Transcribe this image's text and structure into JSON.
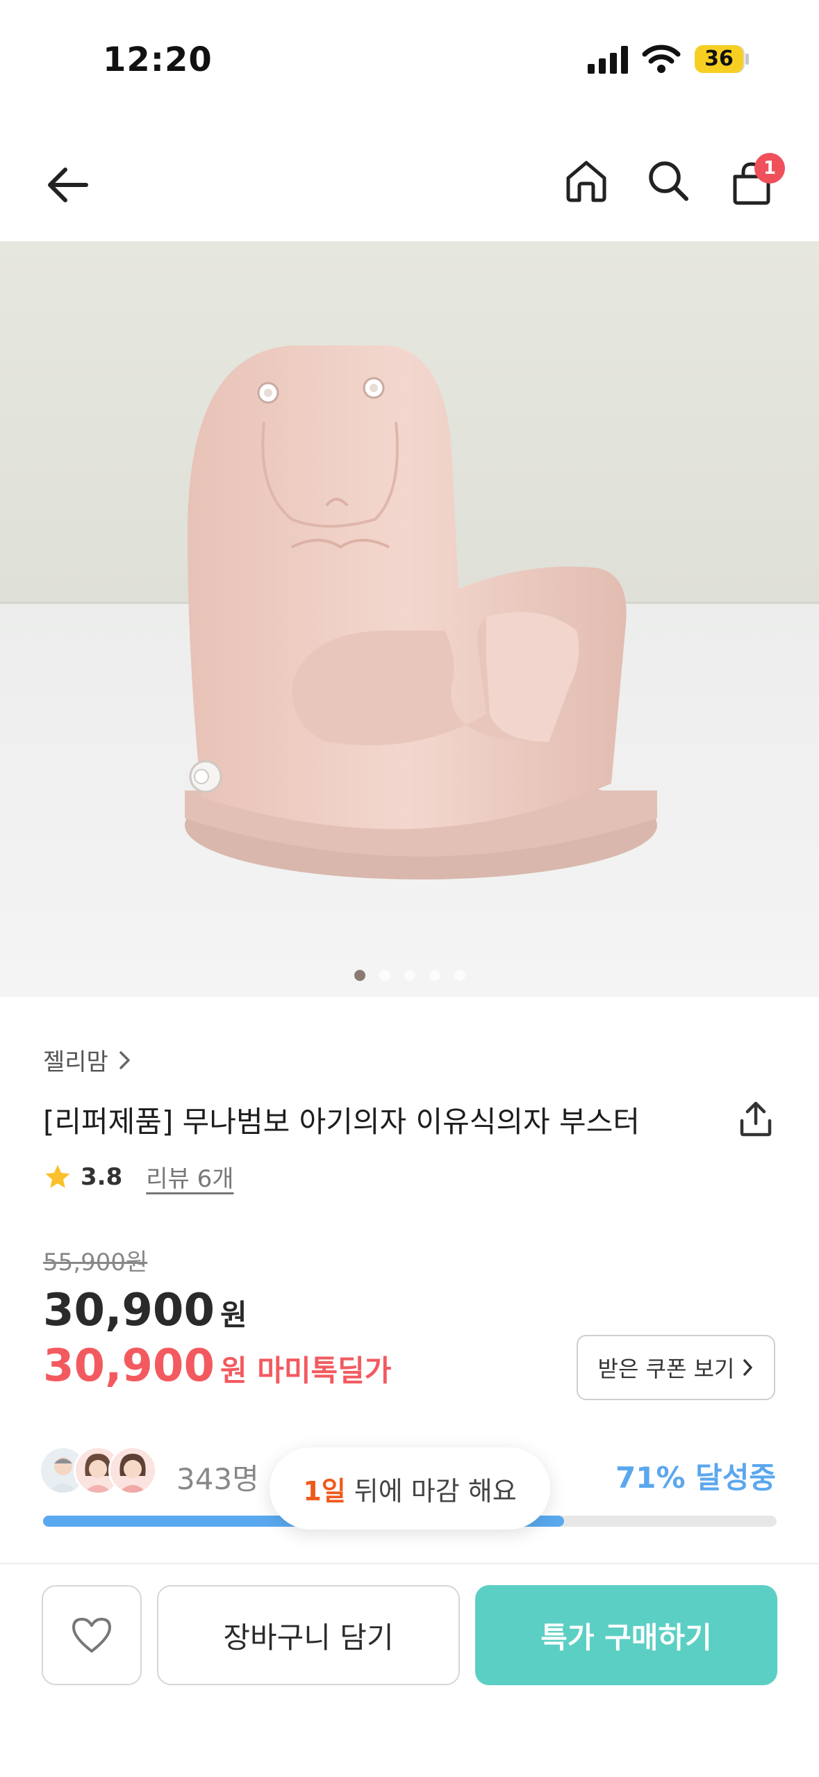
{
  "status_bar": {
    "time": "12:20",
    "battery": "36",
    "icons": [
      "cellular-signal-icon",
      "wifi-icon",
      "battery-icon"
    ]
  },
  "nav": {
    "icons": [
      "back-arrow-icon",
      "home-icon",
      "search-icon",
      "shopping-bag-icon"
    ],
    "cart_badge": "1"
  },
  "gallery": {
    "image_alt": "pink baby booster seat photo",
    "total_images": 5,
    "active_index": 0
  },
  "product": {
    "brand": "젤리맘",
    "title": "[리퍼제품] 무나범보 아기의자 이유식의자 부스터",
    "rating": "3.8",
    "review_label": "리뷰 6개",
    "original_price": "55,900원",
    "price": "30,900",
    "price_unit": "원",
    "deal_price": "30,900",
    "deal_unit": "원 마미톡딜가",
    "coupon_button": "받은 쿠폰 보기"
  },
  "group_buy": {
    "participants": "343명",
    "progress_label": "71% 달성중",
    "progress_fraction": 0.71,
    "deadline_days": "1일",
    "deadline_text": "뒤에 마감 해요"
  },
  "bottom_bar": {
    "add_to_cart": "장바구니 담기",
    "buy_now": "특가 구매하기"
  },
  "colors": {
    "deal_red": "#f25a5f",
    "progress_blue": "#5aa9ef",
    "buy_teal": "#5ccfc4",
    "badge_red": "#f0505a",
    "deadline_orange": "#f05a1a"
  }
}
